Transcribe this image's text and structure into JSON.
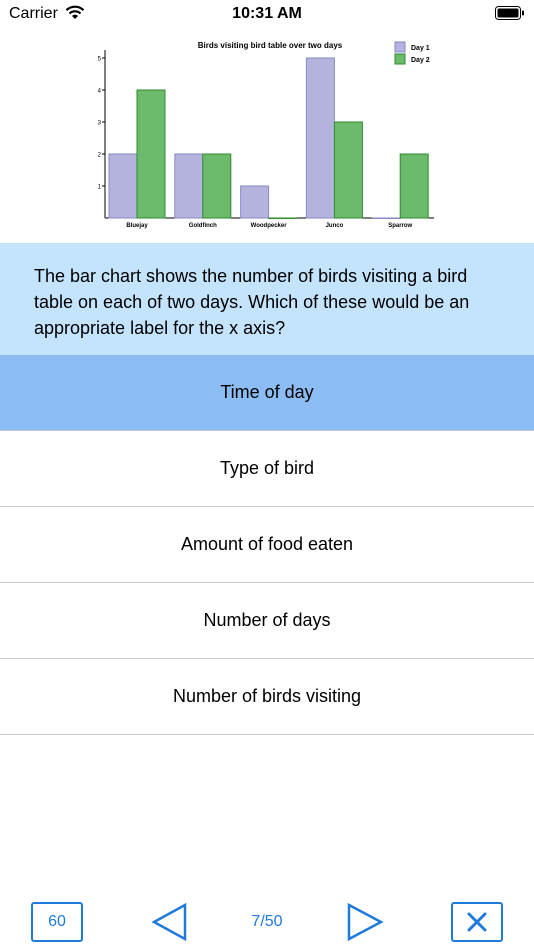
{
  "status": {
    "carrier": "Carrier",
    "time": "10:31 AM"
  },
  "chart_data": {
    "type": "bar",
    "title": "Birds visiting bird table over two days",
    "categories": [
      "Bluejay",
      "Goldfinch",
      "Woodpecker",
      "Junco",
      "Sparrow"
    ],
    "series": [
      {
        "name": "Day 1",
        "values": [
          2,
          2,
          1,
          5,
          0
        ],
        "color": "#b3b3dd"
      },
      {
        "name": "Day 2",
        "values": [
          4,
          2,
          0,
          3,
          2
        ],
        "color": "#6cbb6c"
      }
    ],
    "yticks": [
      "1",
      "2",
      "3",
      "4",
      "5"
    ],
    "ylim": [
      0,
      5
    ],
    "xlabel": "",
    "ylabel": "",
    "legend": "top-right",
    "grid": false
  },
  "question": "The bar chart shows the number of birds visiting a bird table on each of two days. Which of these would be an appropriate label for the x axis?",
  "answers": [
    {
      "label": "Time of day",
      "selected": true
    },
    {
      "label": "Type of bird",
      "selected": false
    },
    {
      "label": "Amount of food eaten",
      "selected": false
    },
    {
      "label": "Number of days",
      "selected": false
    },
    {
      "label": "Number of birds visiting",
      "selected": false
    }
  ],
  "footer": {
    "timer": "60",
    "progress": "7/50",
    "accent": "#1f7ad9"
  },
  "icons": {
    "prev": "triangle-left-icon",
    "next": "triangle-right-icon",
    "close": "close-icon",
    "wifi": "wifi-icon",
    "battery": "battery-icon"
  }
}
